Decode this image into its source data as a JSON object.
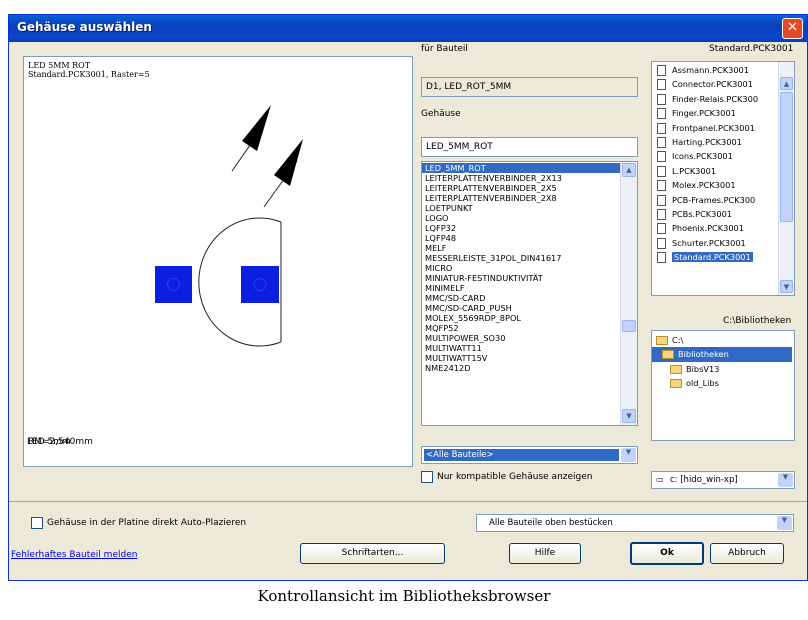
{
  "window": {
    "title": "Gehäuse auswählen"
  },
  "preview": {
    "line1": "LED 5MM ROT",
    "line2": "Standard.PCK3001, Raster=5",
    "rm": "RM=2,540mm",
    "description": "LED 5mm"
  },
  "bauteil": {
    "label": "für Bauteil",
    "value": "D1, LED_ROT_5MM"
  },
  "gehaeuse": {
    "label": "Gehäuse",
    "value": "LED_5MM_ROT",
    "items": [
      "LED_5MM_ROT",
      "LEITERPLATTENVERBINDER_2X13",
      "LEITERPLATTENVERBINDER_2X5",
      "LEITERPLATTENVERBINDER_2X8",
      "LOETPUNKT",
      "LOGO",
      "LQFP32",
      "LQFP48",
      "MELF",
      "MESSERLEISTE_31POL_DIN41617",
      "MICRO",
      "MINIATUR-FESTINDUKTIVITÄT",
      "MINIMELF",
      "MMC/SD-CARD",
      "MMC/SD-CARD_PUSH",
      "MOLEX_5569RDP_8POL",
      "MQFP52",
      "MULTIPOWER_SO30",
      "MULTIWATT11",
      "MULTIWATT15V",
      "NME2412D"
    ]
  },
  "filter": {
    "value": "<Alle Bauteile>",
    "compatible_label": "Nur kompatible Gehäuse anzeigen"
  },
  "library": {
    "header": "Standard.PCK3001",
    "files": [
      "Assmann.PCK3001",
      "Connector.PCK3001",
      "Finder-Relais.PCK300",
      "Finger.PCK3001",
      "Frontpanel.PCK3001",
      "Harting.PCK3001",
      "Icons.PCK3001",
      "L.PCK3001",
      "Molex.PCK3001",
      "PCB-Frames.PCK300",
      "PCBs.PCK3001",
      "Phoenix.PCK3001",
      "Schurter.PCK3001",
      "Standard.PCK3001"
    ],
    "path": "C:\\Bibliotheken",
    "folders": [
      "C:\\",
      "Bibliotheken",
      "BibsV13",
      "old_Libs"
    ],
    "drive": "c: [hido_win-xp]"
  },
  "bottom": {
    "autoplace_label": "Gehäuse in der Platine direkt Auto-Plazieren",
    "placement_value": "Alle Bauteile oben bestücken",
    "report_link": "Fehlerhaftes Bauteil melden",
    "fonts_button": "Schriftarten...",
    "help_button": "Hilfe",
    "ok_button": "Ok",
    "cancel_button": "Abbruch"
  },
  "caption": "Kontrollansicht im Bibliotheksbrowser",
  "colors": {
    "titlebar": "#0b46c9",
    "selection": "#316ac5",
    "pad": "#0a1fe0"
  }
}
